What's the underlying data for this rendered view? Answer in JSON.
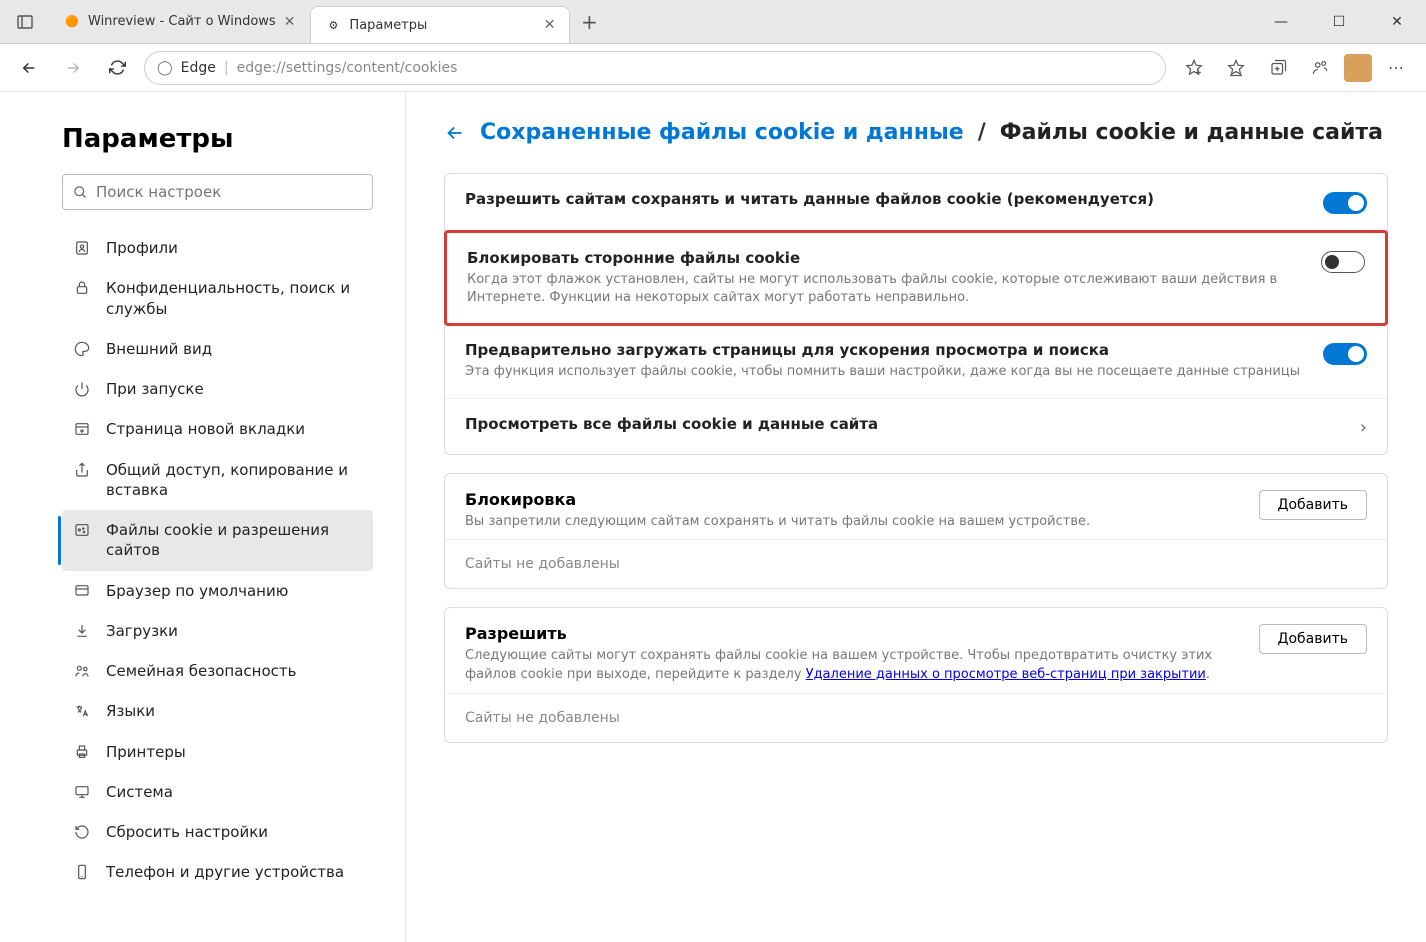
{
  "tabs": [
    {
      "title": "Winreview - Сайт о Windows"
    },
    {
      "title": "Параметры"
    }
  ],
  "addressbar": {
    "prefix": "Edge",
    "url": "edge://settings/content/cookies"
  },
  "sidebar": {
    "heading": "Параметры",
    "search_placeholder": "Поиск настроек",
    "items": [
      {
        "label": "Профили"
      },
      {
        "label": "Конфиденциальность, поиск и службы"
      },
      {
        "label": "Внешний вид"
      },
      {
        "label": "При запуске"
      },
      {
        "label": "Страница новой вкладки"
      },
      {
        "label": "Общий доступ, копирование и вставка"
      },
      {
        "label": "Файлы cookie и разрешения сайтов"
      },
      {
        "label": "Браузер по умолчанию"
      },
      {
        "label": "Загрузки"
      },
      {
        "label": "Семейная безопасность"
      },
      {
        "label": "Языки"
      },
      {
        "label": "Принтеры"
      },
      {
        "label": "Система"
      },
      {
        "label": "Сбросить настройки"
      },
      {
        "label": "Телефон и другие устройства"
      }
    ]
  },
  "breadcrumb": {
    "parent": "Сохраненные файлы cookie и данные",
    "current": "Файлы cookie и данные сайта"
  },
  "settings": {
    "allow_cookies": {
      "title": "Разрешить сайтам сохранять и читать данные файлов cookie (рекомендуется)"
    },
    "block_third_party": {
      "title": "Блокировать сторонние файлы cookie",
      "desc": "Когда этот флажок установлен, сайты не могут использовать файлы cookie, которые отслеживают ваши действия в Интернете. Функции на некоторых сайтах могут работать неправильно."
    },
    "preload": {
      "title": "Предварительно загружать страницы для ускорения просмотра и поиска",
      "desc": "Эта функция использует файлы cookie, чтобы помнить ваши настройки, даже когда вы не посещаете данные страницы"
    },
    "view_all": {
      "title": "Просмотреть все файлы cookie и данные сайта"
    }
  },
  "block_section": {
    "title": "Блокировка",
    "desc": "Вы запретили следующим сайтам сохранять и читать файлы cookie на вашем устройстве.",
    "add": "Добавить",
    "empty": "Сайты не добавлены"
  },
  "allow_section": {
    "title": "Разрешить",
    "desc_pre": "Следующие сайты могут сохранять файлы cookie на вашем устройстве. Чтобы предотвратить очистку этих файлов cookie при выходе, перейдите к разделу ",
    "link": "Удаление данных о просмотре веб-страниц при закрытии",
    "desc_post": ".",
    "add": "Добавить",
    "empty": "Сайты не добавлены"
  }
}
